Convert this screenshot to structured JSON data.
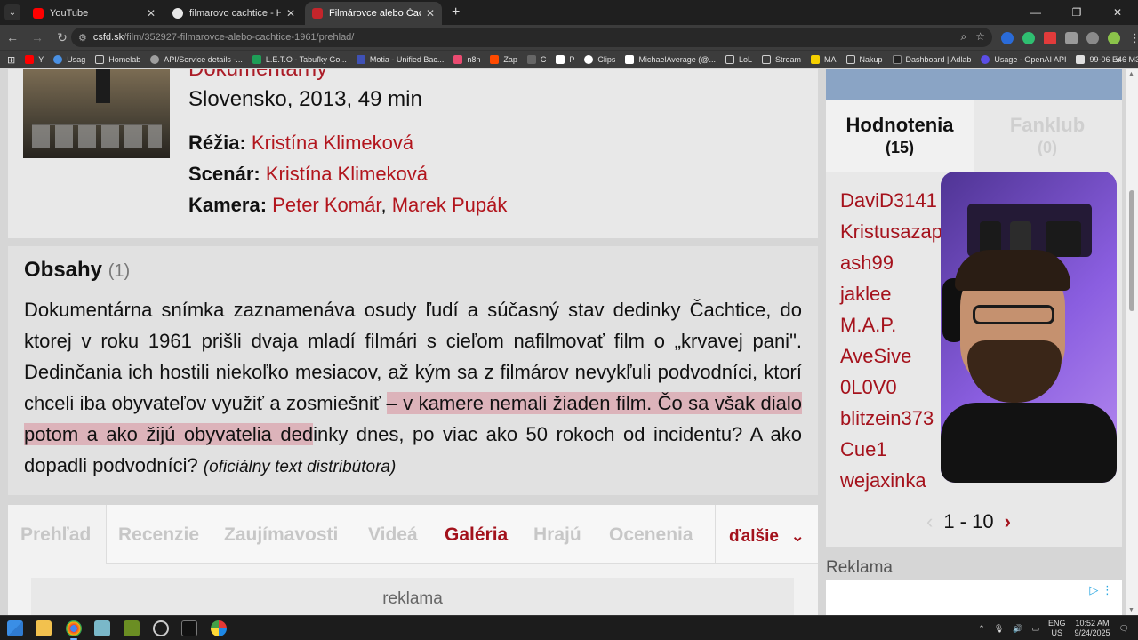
{
  "browser": {
    "tabs": [
      {
        "title": "YouTube",
        "active": false,
        "favicon_color": "#ff0000"
      },
      {
        "title": "filmarovo cachtice - Hľadať Go",
        "active": false,
        "favicon_color": "#e8e8e8"
      },
      {
        "title": "Filmárovce alebo Čachtice 1961",
        "active": true,
        "favicon_color": "#c4252b"
      }
    ],
    "new_tab": "+",
    "window_controls": [
      "—",
      "❐",
      "✕"
    ],
    "url_domain": "csfd.sk",
    "url_path": "/film/352927-filmarovce-alebo-cachtice-1961/prehlad/",
    "bookmarks": [
      {
        "label": "Y",
        "color": "#ff0000"
      },
      {
        "label": "Usag",
        "color": "#4a90e2"
      },
      {
        "label": "Homelab",
        "color": "#cfcfcf"
      },
      {
        "label": "API/Service details -...",
        "color": "#9e9e9e"
      },
      {
        "label": "L.E.T.O - Tabuľky Go...",
        "color": "#1e9e57"
      },
      {
        "label": "Motia - Unified Bac...",
        "color": "#3f51b5"
      },
      {
        "label": "n8n",
        "color": "#ea4b71"
      },
      {
        "label": "Zap",
        "color": "#ff4a00"
      },
      {
        "label": "C",
        "color": "#666666"
      },
      {
        "label": "P",
        "color": "#ffffff"
      },
      {
        "label": "Clips",
        "color": "#ffffff"
      },
      {
        "label": "MichaelAverage (@...",
        "color": "#ffffff"
      },
      {
        "label": "LoL",
        "color": "#cfcfcf"
      },
      {
        "label": "Stream",
        "color": "#cfcfcf"
      },
      {
        "label": "MA",
        "color": "#f5d000"
      },
      {
        "label": "Nakup",
        "color": "#cfcfcf"
      },
      {
        "label": "Dashboard | Adlab",
        "color": "#222222"
      },
      {
        "label": "Usage - OpenAI API",
        "color": "#5b4ee6"
      },
      {
        "label": "99-06 E46 M3 Floor...",
        "color": "#e0e0e0"
      }
    ],
    "bookmarks_more": "»"
  },
  "film": {
    "genre": "Dokumentárny",
    "origin": "Slovensko, 2013, 49 min",
    "director_label": "Réžia:",
    "director": "Kristína Klimeková",
    "writer_label": "Scenár:",
    "writer": "Kristína Klimeková",
    "camera_label": "Kamera:",
    "camera_1": "Peter Komár",
    "camera_sep": ",",
    "camera_2": "Marek Pupák"
  },
  "synopsis": {
    "heading": "Obsahy",
    "count": "(1)",
    "text_plain": "Dokumentárna snímka zaznamenáva osudy ľudí a súčasný stav dedinky Čachtice, do ktorej v roku 1961 prišli dvaja mladí filmári s cieľom nafilmovať film o „krvavej pani\". Dedinčania ich hostili niekoľko mesiacov, až kým sa z filmárov nevykľuli podvodníci, ktorí chceli iba obyvateľov využiť a zosmiešniť ",
    "text_highlighted": "– v kamere nemali žiaden film. Čo sa však dialo potom a ako žijú obyvatelia ded",
    "text_rest": "inky dnes, po viac ako 50 rokoch od incidentu? A ako dopadli podvodníci? ",
    "source": "(oficiálny text distribútora)"
  },
  "film_tabs": [
    "Prehľad",
    "Recenzie",
    "Zaujímavosti",
    "Videá",
    "Galéria",
    "Hrajú",
    "Ocenenia"
  ],
  "active_tab": "Galéria",
  "more_tab": "ďalšie",
  "ad_strip_label": "reklama",
  "ratings": {
    "tab_active": "Hodnotenia",
    "tab_active_count": "(15)",
    "tab_inactive": "Fanklub",
    "tab_inactive_count": "(0)",
    "users": [
      "DaviD3141",
      "Kristusazap",
      "ash99",
      "jaklee",
      "M.A.P.",
      "AveSive",
      "0L0V0",
      "blitzein373",
      "Cue1",
      "wejaxinka"
    ],
    "last_rating": "★★★",
    "pager_range": "1 - 10"
  },
  "sidebar_ad_label": "Reklama",
  "taskbar": {
    "lang_top": "ENG",
    "lang_bottom": "US",
    "time": "10:52 AM",
    "date": "9/24/2025"
  }
}
